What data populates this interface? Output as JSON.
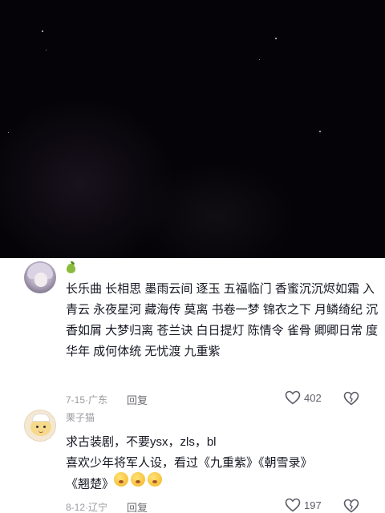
{
  "comments": [
    {
      "username": "",
      "text": "长乐曲 长相思 墨雨云间 逐玉 五福临门 香蜜沉沉烬如霜 入青云 永夜星河 藏海传 莫离 书卷一梦 锦衣之下 月鳞绮纪 沉香如屑 大梦归离 苍兰诀 白日提灯 陈情令 雀骨 卿卿日常 度华年 成何体统 无忧渡 九重紫",
      "date": "7-15",
      "location": "广东",
      "reply_label": "回复",
      "likes": "402",
      "badge_icon": "pear-badge-icon"
    },
    {
      "username": "栗子猫",
      "text_line1": "求古装剧，不要ysx，zls，bl",
      "text_line2": "喜欢少年将军人设，看过《九重紫》《朝雪录》",
      "text_line3": "《翘楚》",
      "emoji_icon": "pleading-face-emoji",
      "date": "8-12",
      "location": "辽宁",
      "reply_label": "回复",
      "likes": "197"
    }
  ],
  "separator": "·",
  "colors": {
    "meta_gray": "#9a9aa0",
    "text": "#161823",
    "video_bg": "#050308"
  }
}
